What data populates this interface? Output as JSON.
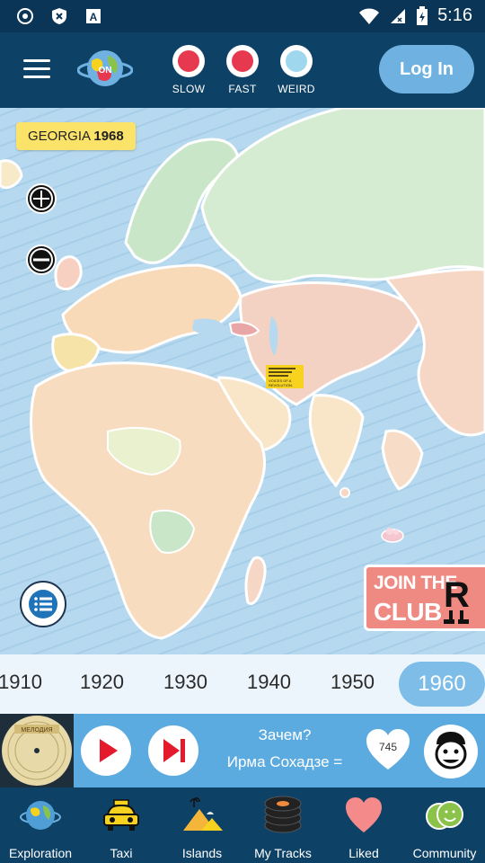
{
  "status_bar": {
    "time": "5:16"
  },
  "top_bar": {
    "speeds": [
      {
        "label": "SLOW",
        "color": "#e63950"
      },
      {
        "label": "FAST",
        "color": "#e63950"
      },
      {
        "label": "WEIRD",
        "color": "#9fd7ef"
      }
    ],
    "login_label": "Log In"
  },
  "map": {
    "country_name": "GEORGIA",
    "country_year": "1968",
    "club_line1": "JOIN THE",
    "club_line2": "CLUB",
    "club_logo_letter": "R",
    "marker_text": "VOICES OF A REVOLUTION."
  },
  "timeline": {
    "decades": [
      "1910",
      "1920",
      "1930",
      "1940",
      "1950",
      "1960"
    ],
    "active": "1960"
  },
  "player": {
    "record_label": "МЕЛОДИЯ",
    "title": "Зачем?",
    "artist": "Ирма Сохадзе =",
    "likes": "745"
  },
  "nav": {
    "items": [
      {
        "label": "Exploration",
        "icon": "globe-icon"
      },
      {
        "label": "Taxi",
        "icon": "taxi-icon"
      },
      {
        "label": "Islands",
        "icon": "islands-icon"
      },
      {
        "label": "My Tracks",
        "icon": "records-icon"
      },
      {
        "label": "Liked",
        "icon": "heart-icon"
      },
      {
        "label": "Community",
        "icon": "community-icon"
      }
    ]
  },
  "colors": {
    "bar_bg": "#0d4166",
    "accent": "#5cabe0",
    "ocean": "#b7d9ef",
    "tag_yellow": "#fbe36a",
    "club_pink": "#ef8a83"
  }
}
